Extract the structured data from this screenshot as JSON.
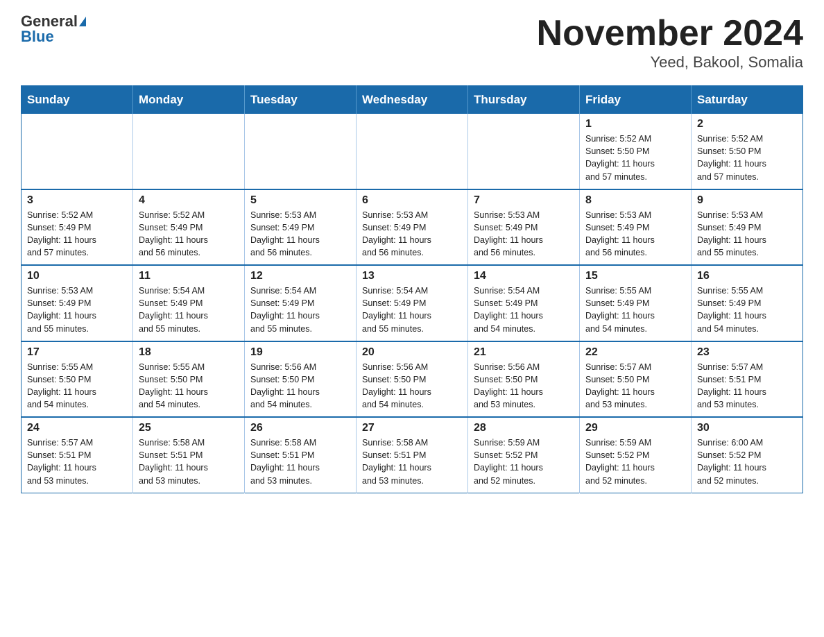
{
  "header": {
    "logo_general": "General",
    "logo_blue": "Blue",
    "month_title": "November 2024",
    "location": "Yeed, Bakool, Somalia"
  },
  "weekdays": [
    "Sunday",
    "Monday",
    "Tuesday",
    "Wednesday",
    "Thursday",
    "Friday",
    "Saturday"
  ],
  "weeks": [
    [
      {
        "day": "",
        "info": ""
      },
      {
        "day": "",
        "info": ""
      },
      {
        "day": "",
        "info": ""
      },
      {
        "day": "",
        "info": ""
      },
      {
        "day": "",
        "info": ""
      },
      {
        "day": "1",
        "info": "Sunrise: 5:52 AM\nSunset: 5:50 PM\nDaylight: 11 hours\nand 57 minutes."
      },
      {
        "day": "2",
        "info": "Sunrise: 5:52 AM\nSunset: 5:50 PM\nDaylight: 11 hours\nand 57 minutes."
      }
    ],
    [
      {
        "day": "3",
        "info": "Sunrise: 5:52 AM\nSunset: 5:49 PM\nDaylight: 11 hours\nand 57 minutes."
      },
      {
        "day": "4",
        "info": "Sunrise: 5:52 AM\nSunset: 5:49 PM\nDaylight: 11 hours\nand 56 minutes."
      },
      {
        "day": "5",
        "info": "Sunrise: 5:53 AM\nSunset: 5:49 PM\nDaylight: 11 hours\nand 56 minutes."
      },
      {
        "day": "6",
        "info": "Sunrise: 5:53 AM\nSunset: 5:49 PM\nDaylight: 11 hours\nand 56 minutes."
      },
      {
        "day": "7",
        "info": "Sunrise: 5:53 AM\nSunset: 5:49 PM\nDaylight: 11 hours\nand 56 minutes."
      },
      {
        "day": "8",
        "info": "Sunrise: 5:53 AM\nSunset: 5:49 PM\nDaylight: 11 hours\nand 56 minutes."
      },
      {
        "day": "9",
        "info": "Sunrise: 5:53 AM\nSunset: 5:49 PM\nDaylight: 11 hours\nand 55 minutes."
      }
    ],
    [
      {
        "day": "10",
        "info": "Sunrise: 5:53 AM\nSunset: 5:49 PM\nDaylight: 11 hours\nand 55 minutes."
      },
      {
        "day": "11",
        "info": "Sunrise: 5:54 AM\nSunset: 5:49 PM\nDaylight: 11 hours\nand 55 minutes."
      },
      {
        "day": "12",
        "info": "Sunrise: 5:54 AM\nSunset: 5:49 PM\nDaylight: 11 hours\nand 55 minutes."
      },
      {
        "day": "13",
        "info": "Sunrise: 5:54 AM\nSunset: 5:49 PM\nDaylight: 11 hours\nand 55 minutes."
      },
      {
        "day": "14",
        "info": "Sunrise: 5:54 AM\nSunset: 5:49 PM\nDaylight: 11 hours\nand 54 minutes."
      },
      {
        "day": "15",
        "info": "Sunrise: 5:55 AM\nSunset: 5:49 PM\nDaylight: 11 hours\nand 54 minutes."
      },
      {
        "day": "16",
        "info": "Sunrise: 5:55 AM\nSunset: 5:49 PM\nDaylight: 11 hours\nand 54 minutes."
      }
    ],
    [
      {
        "day": "17",
        "info": "Sunrise: 5:55 AM\nSunset: 5:50 PM\nDaylight: 11 hours\nand 54 minutes."
      },
      {
        "day": "18",
        "info": "Sunrise: 5:55 AM\nSunset: 5:50 PM\nDaylight: 11 hours\nand 54 minutes."
      },
      {
        "day": "19",
        "info": "Sunrise: 5:56 AM\nSunset: 5:50 PM\nDaylight: 11 hours\nand 54 minutes."
      },
      {
        "day": "20",
        "info": "Sunrise: 5:56 AM\nSunset: 5:50 PM\nDaylight: 11 hours\nand 54 minutes."
      },
      {
        "day": "21",
        "info": "Sunrise: 5:56 AM\nSunset: 5:50 PM\nDaylight: 11 hours\nand 53 minutes."
      },
      {
        "day": "22",
        "info": "Sunrise: 5:57 AM\nSunset: 5:50 PM\nDaylight: 11 hours\nand 53 minutes."
      },
      {
        "day": "23",
        "info": "Sunrise: 5:57 AM\nSunset: 5:51 PM\nDaylight: 11 hours\nand 53 minutes."
      }
    ],
    [
      {
        "day": "24",
        "info": "Sunrise: 5:57 AM\nSunset: 5:51 PM\nDaylight: 11 hours\nand 53 minutes."
      },
      {
        "day": "25",
        "info": "Sunrise: 5:58 AM\nSunset: 5:51 PM\nDaylight: 11 hours\nand 53 minutes."
      },
      {
        "day": "26",
        "info": "Sunrise: 5:58 AM\nSunset: 5:51 PM\nDaylight: 11 hours\nand 53 minutes."
      },
      {
        "day": "27",
        "info": "Sunrise: 5:58 AM\nSunset: 5:51 PM\nDaylight: 11 hours\nand 53 minutes."
      },
      {
        "day": "28",
        "info": "Sunrise: 5:59 AM\nSunset: 5:52 PM\nDaylight: 11 hours\nand 52 minutes."
      },
      {
        "day": "29",
        "info": "Sunrise: 5:59 AM\nSunset: 5:52 PM\nDaylight: 11 hours\nand 52 minutes."
      },
      {
        "day": "30",
        "info": "Sunrise: 6:00 AM\nSunset: 5:52 PM\nDaylight: 11 hours\nand 52 minutes."
      }
    ]
  ]
}
